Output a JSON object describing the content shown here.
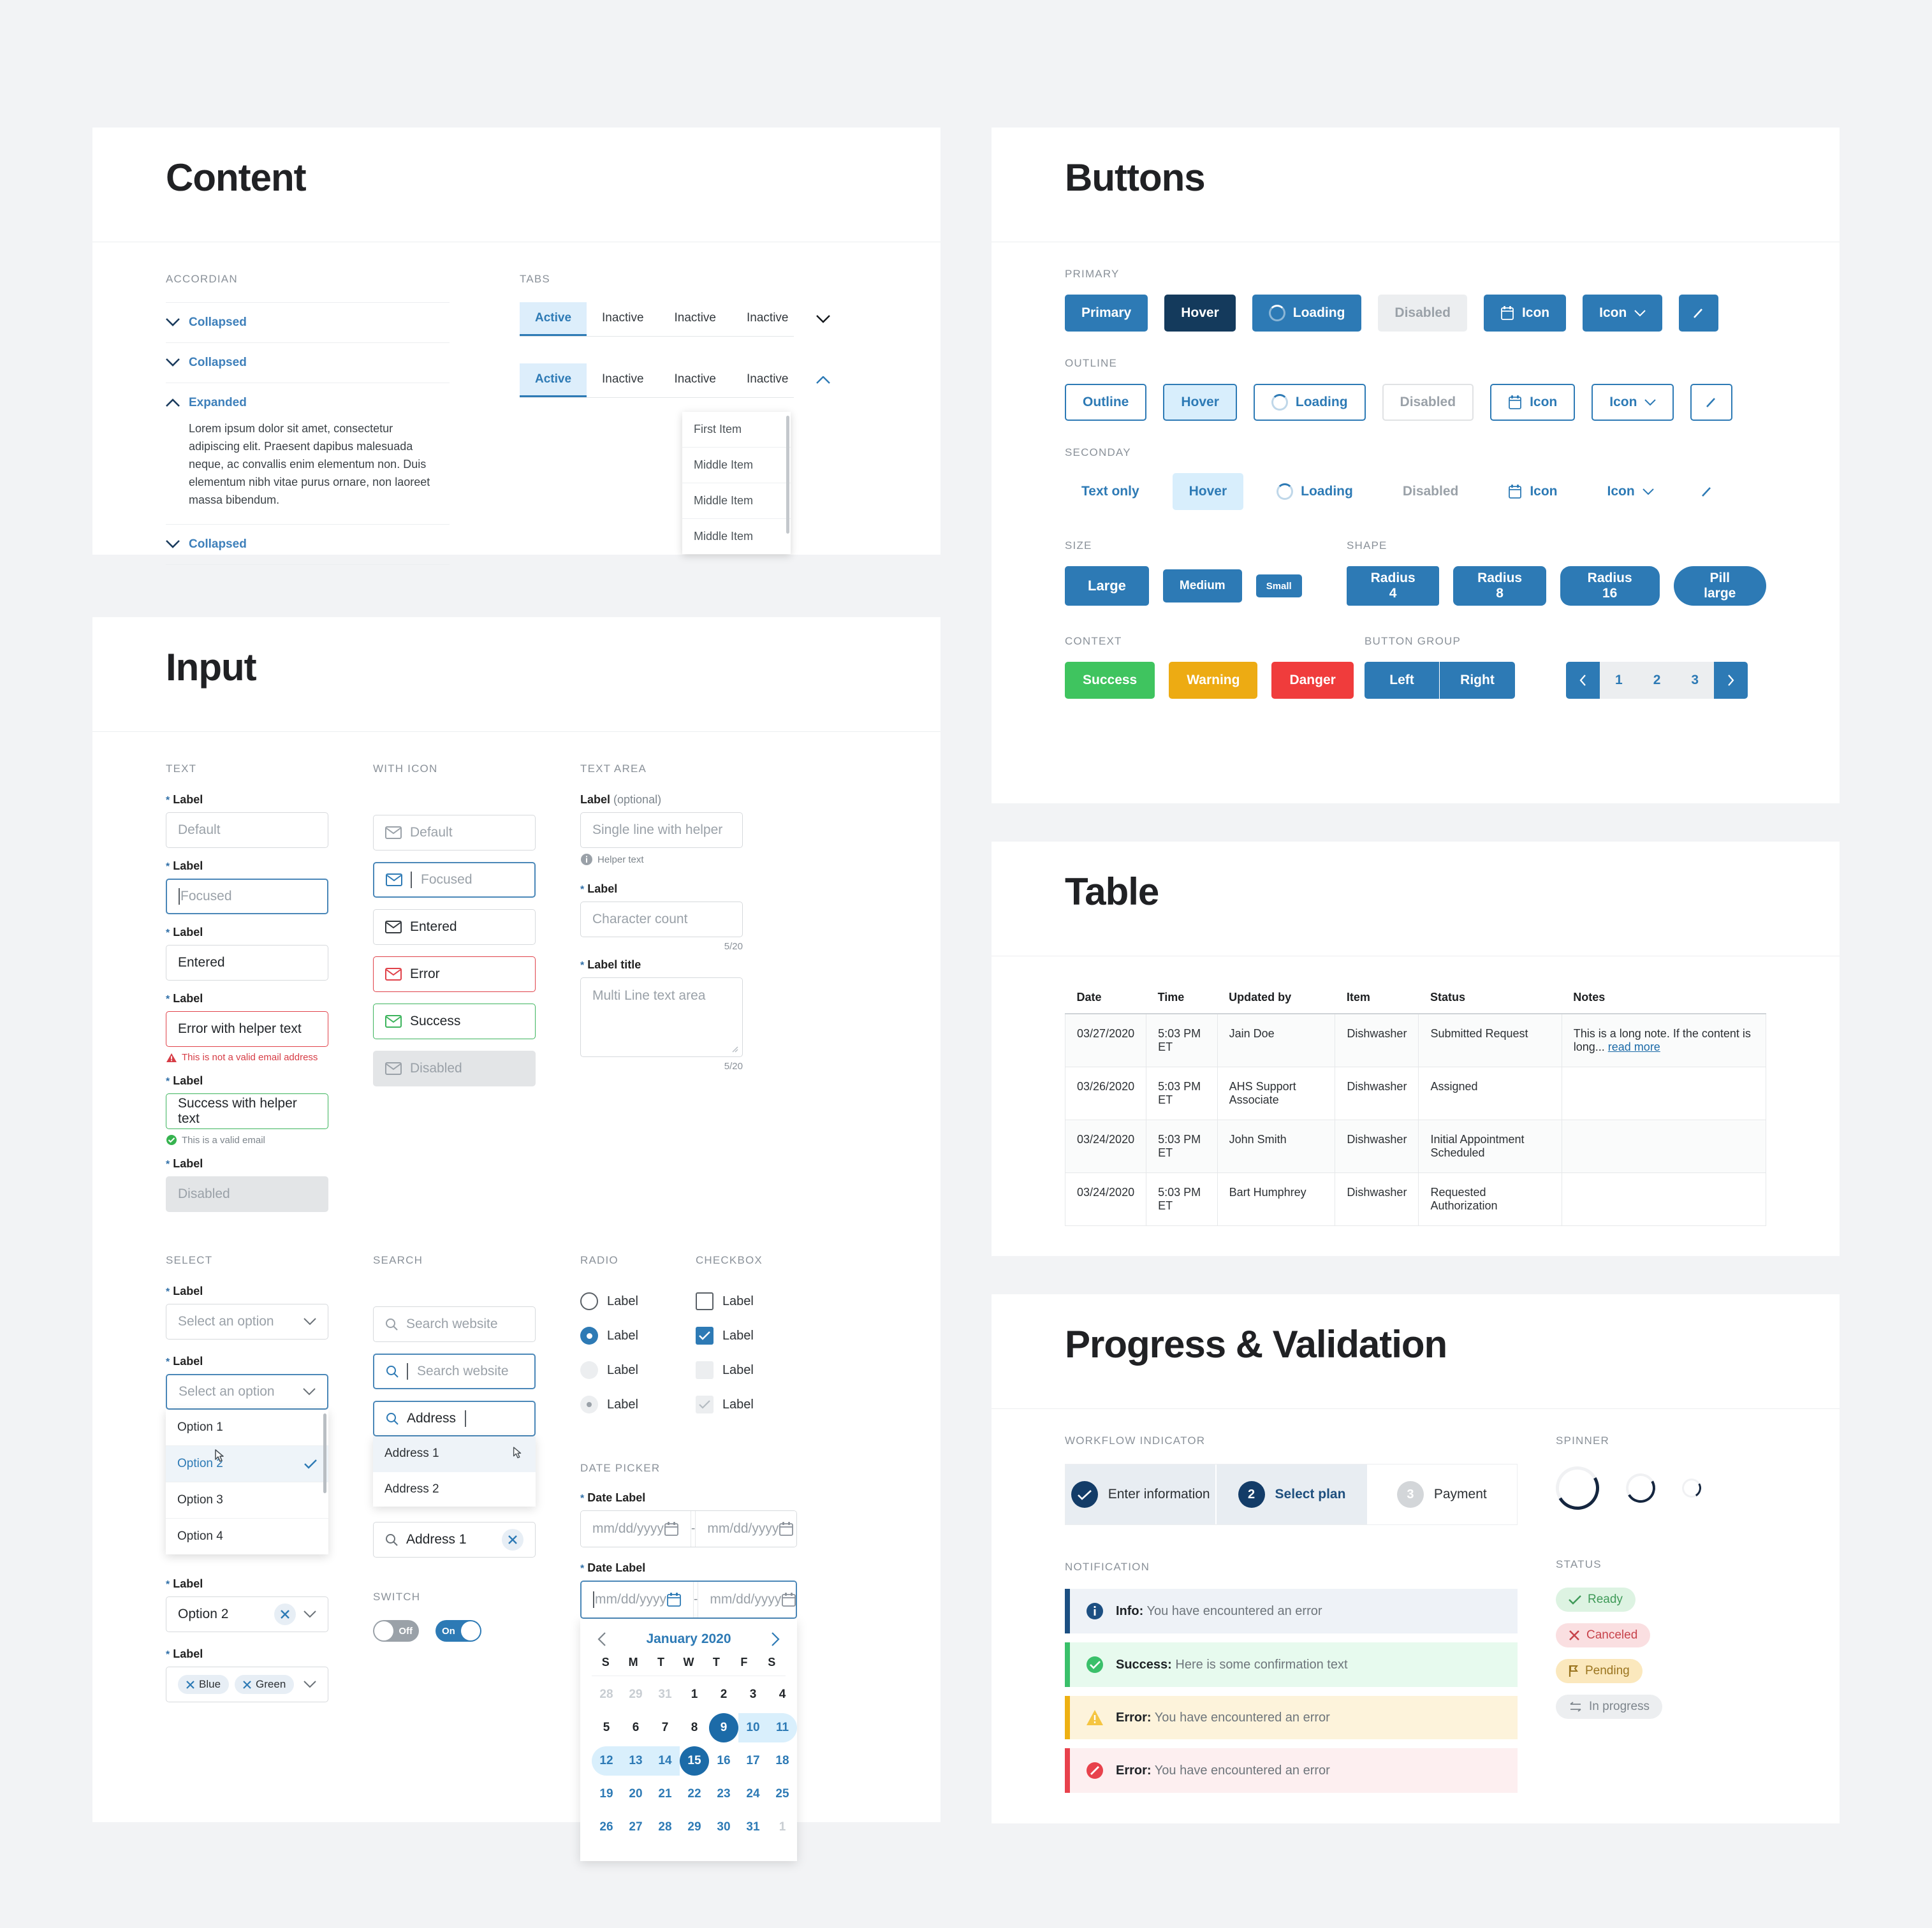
{
  "panels": {
    "content": {
      "title": "Content",
      "accordion": {
        "label": "ACCORDIAN",
        "items": [
          {
            "label": "Collapsed",
            "state": "collapsed"
          },
          {
            "label": "Collapsed",
            "state": "collapsed"
          },
          {
            "label": "Expanded",
            "state": "expanded",
            "body": "Lorem ipsum dolor sit amet, consectetur adipiscing elit. Praesent dapibus malesuada neque, ac convallis enim elementum non. Duis elementum nibh vitae purus ornare, non laoreet massa bibendum."
          },
          {
            "label": "Collapsed",
            "state": "collapsed"
          }
        ]
      },
      "tabs": {
        "label": "TABS",
        "items": [
          "Active",
          "Inactive",
          "Inactive",
          "Inactive"
        ],
        "menu": [
          "First Item",
          "Middle Item",
          "Middle Item",
          "Middle Item"
        ]
      }
    },
    "input": {
      "title": "Input",
      "text": {
        "label": "TEXT",
        "fields": [
          {
            "label": "Label",
            "value": "Default",
            "state": "default"
          },
          {
            "label": "Label",
            "value": "Focused",
            "state": "focus"
          },
          {
            "label": "Label",
            "value": "Entered",
            "state": "entered"
          },
          {
            "label": "Label",
            "value": "Error with helper text",
            "state": "error",
            "helper": "This is not a valid email address"
          },
          {
            "label": "Label",
            "value": "Success with helper text",
            "state": "success",
            "helper": "This is a valid email"
          },
          {
            "label": "Label",
            "value": "Disabled",
            "state": "disabled"
          }
        ]
      },
      "with_icon": {
        "label": "WITH ICON",
        "fields": [
          {
            "value": "Default",
            "state": "default"
          },
          {
            "value": "Focused",
            "state": "focus"
          },
          {
            "value": "Entered",
            "state": "entered"
          },
          {
            "value": "Error",
            "state": "error"
          },
          {
            "value": "Success",
            "state": "success"
          },
          {
            "value": "Disabled",
            "state": "disabled"
          }
        ]
      },
      "text_area": {
        "label": "TEXT AREA",
        "single": {
          "label": "Label",
          "optional": "(optional)",
          "placeholder": "Single line with helper",
          "helper": "Helper text"
        },
        "counted": {
          "label": "Label",
          "placeholder": "Character count",
          "count": "5/20"
        },
        "multi": {
          "label": "Label title",
          "placeholder": "Multi Line text area",
          "count": "5/20"
        }
      },
      "select": {
        "label": "SELECT",
        "fields": [
          {
            "label": "Label",
            "value": "Select an option",
            "state": "default"
          },
          {
            "label": "Label",
            "value": "Select an option",
            "state": "open"
          },
          {
            "label": "Label",
            "value": "Option 2",
            "state": "clearable"
          },
          {
            "label": "Label",
            "state": "tags",
            "tags": [
              "Blue",
              "Green"
            ]
          }
        ],
        "options": [
          "Option 1",
          "Option 2",
          "Option 3",
          "Option 4"
        ],
        "selected_option": "Option 2"
      },
      "search": {
        "label": "SEARCH",
        "fields": [
          {
            "value": "Search website",
            "state": "default"
          },
          {
            "value": "Search website",
            "state": "focus"
          },
          {
            "value": "Address",
            "state": "typing"
          },
          {
            "value": "Address 1",
            "state": "filled"
          }
        ],
        "results": [
          "Address 1",
          "Address 2"
        ]
      },
      "radio": {
        "label": "RADIO",
        "items": [
          "Label",
          "Label",
          "Label",
          "Label"
        ]
      },
      "checkbox": {
        "label": "CHECKBOX",
        "items": [
          "Label",
          "Label",
          "Label",
          "Label"
        ]
      },
      "switch": {
        "label": "SWITCH",
        "off_label": "Off",
        "on_label": "On"
      },
      "date_picker": {
        "label": "DATE PICKER",
        "rows": [
          {
            "label": "Date Label",
            "start": "mm/dd/yyyy",
            "end": "mm/dd/yyyy",
            "sep": "-",
            "state": "default"
          },
          {
            "label": "Date Label",
            "start": "mm/dd/yyyy",
            "end": "mm/dd/yyyy",
            "sep": "-",
            "state": "focus"
          }
        ],
        "calendar": {
          "month": "January 2020",
          "weekdays": [
            "S",
            "M",
            "T",
            "W",
            "T",
            "F",
            "S"
          ],
          "weeks": [
            [
              {
                "d": "28",
                "o": true
              },
              {
                "d": "29",
                "o": true
              },
              {
                "d": "31",
                "o": true
              },
              {
                "d": "1"
              },
              {
                "d": "2"
              },
              {
                "d": "3"
              },
              {
                "d": "4"
              }
            ],
            [
              {
                "d": "5"
              },
              {
                "d": "6"
              },
              {
                "d": "7"
              },
              {
                "d": "8"
              },
              {
                "d": "9",
                "sel": true,
                "start": true
              },
              {
                "d": "10",
                "rng": true
              },
              {
                "d": "11",
                "rng": true,
                "rend": true
              }
            ],
            [
              {
                "d": "12",
                "rng": true,
                "rstart": true
              },
              {
                "d": "13",
                "rng": true
              },
              {
                "d": "14",
                "rng": true
              },
              {
                "d": "15",
                "sel": true,
                "end": true
              },
              {
                "d": "16",
                "a": true
              },
              {
                "d": "17",
                "a": true
              },
              {
                "d": "18",
                "a": true
              }
            ],
            [
              {
                "d": "19",
                "a": true
              },
              {
                "d": "20",
                "a": true
              },
              {
                "d": "21",
                "a": true
              },
              {
                "d": "22",
                "a": true
              },
              {
                "d": "23",
                "a": true
              },
              {
                "d": "24",
                "a": true
              },
              {
                "d": "25",
                "a": true
              }
            ],
            [
              {
                "d": "26",
                "a": true
              },
              {
                "d": "27",
                "a": true
              },
              {
                "d": "28",
                "a": true
              },
              {
                "d": "29",
                "a": true
              },
              {
                "d": "30",
                "a": true
              },
              {
                "d": "31",
                "a": true
              },
              {
                "d": "1",
                "o": true
              }
            ]
          ]
        }
      }
    },
    "buttons": {
      "title": "Buttons",
      "primary": {
        "label": "PRIMARY",
        "items": [
          "Primary",
          "Hover",
          "Loading",
          "Disabled",
          "Icon",
          "Icon"
        ]
      },
      "outline": {
        "label": "OUTLINE",
        "items": [
          "Outline",
          "Hover",
          "Loading",
          "Disabled",
          "Icon",
          "Icon"
        ]
      },
      "secondary": {
        "label": "SECONDAY",
        "items": [
          "Text only",
          "Hover",
          "Loading",
          "Disabled",
          "Icon",
          "Icon"
        ]
      },
      "size": {
        "label": "SIZE",
        "items": [
          "Large",
          "Medium",
          "Small"
        ]
      },
      "shape": {
        "label": "SHAPE",
        "items": [
          "Radius 4",
          "Radius 8",
          "Radius 16",
          "Pill large"
        ]
      },
      "context": {
        "label": "CONTEXT",
        "items": [
          {
            "text": "Success",
            "color": "#3fc45f"
          },
          {
            "text": "Warning",
            "color": "#edab13"
          },
          {
            "text": "Danger",
            "color": "#f03c3c"
          }
        ]
      },
      "button_group": {
        "label": "BUTTON GROUP",
        "pair": [
          "Left",
          "Right"
        ],
        "pages": [
          "1",
          "2",
          "3"
        ]
      }
    },
    "table": {
      "title": "Table",
      "columns": [
        "Date",
        "Time",
        "Updated by",
        "Item",
        "Status",
        "Notes"
      ],
      "rows": [
        {
          "cells": [
            "03/27/2020",
            "5:03 PM ET",
            "Jain Doe",
            "Dishwasher",
            "Submitted Request",
            "This is a long note. If the content is long..."
          ],
          "link": "read more"
        },
        {
          "cells": [
            "03/26/2020",
            "5:03 PM ET",
            "AHS Support Associate",
            "Dishwasher",
            "Assigned",
            ""
          ]
        },
        {
          "cells": [
            "03/24/2020",
            "5:03 PM ET",
            "John Smith",
            "Dishwasher",
            "Initial Appointment Scheduled",
            ""
          ]
        },
        {
          "cells": [
            "03/24/2020",
            "5:03 PM ET",
            "Bart Humphrey",
            "Dishwasher",
            "Requested Authorization",
            ""
          ]
        }
      ]
    },
    "progress": {
      "title": "Progress & Validation",
      "workflow": {
        "label": "WORKFLOW INDICATOR",
        "steps": [
          {
            "num": "",
            "text": "Enter information",
            "state": "done"
          },
          {
            "num": "2",
            "text": "Select plan",
            "state": "current"
          },
          {
            "num": "3",
            "text": "Payment",
            "state": "upcoming"
          }
        ]
      },
      "notification": {
        "label": "NOTIFICATION",
        "items": [
          {
            "title": "Info:",
            "text": "You have encountered an error",
            "type": "info"
          },
          {
            "title": "Success:",
            "text": "Here is some confirmation text",
            "type": "success"
          },
          {
            "title": "Error:",
            "text": "You have encountered an error",
            "type": "warning"
          },
          {
            "title": "Error:",
            "text": "You have encountered an error",
            "type": "error"
          }
        ]
      },
      "spinner": {
        "label": "SPINNER"
      },
      "status": {
        "label": "STATUS",
        "items": [
          {
            "text": "Ready",
            "icon": "check",
            "bg": "#ddf3e2",
            "fg": "#3f9a58"
          },
          {
            "text": "Canceled",
            "icon": "cross",
            "bg": "#fadfe1",
            "fg": "#c7434b"
          },
          {
            "text": "Pending",
            "icon": "flag",
            "bg": "#fbe8bd",
            "fg": "#9b7520"
          },
          {
            "text": "In progress",
            "icon": "arrows",
            "bg": "#eceef0",
            "fg": "#7d858c"
          }
        ]
      }
    }
  }
}
